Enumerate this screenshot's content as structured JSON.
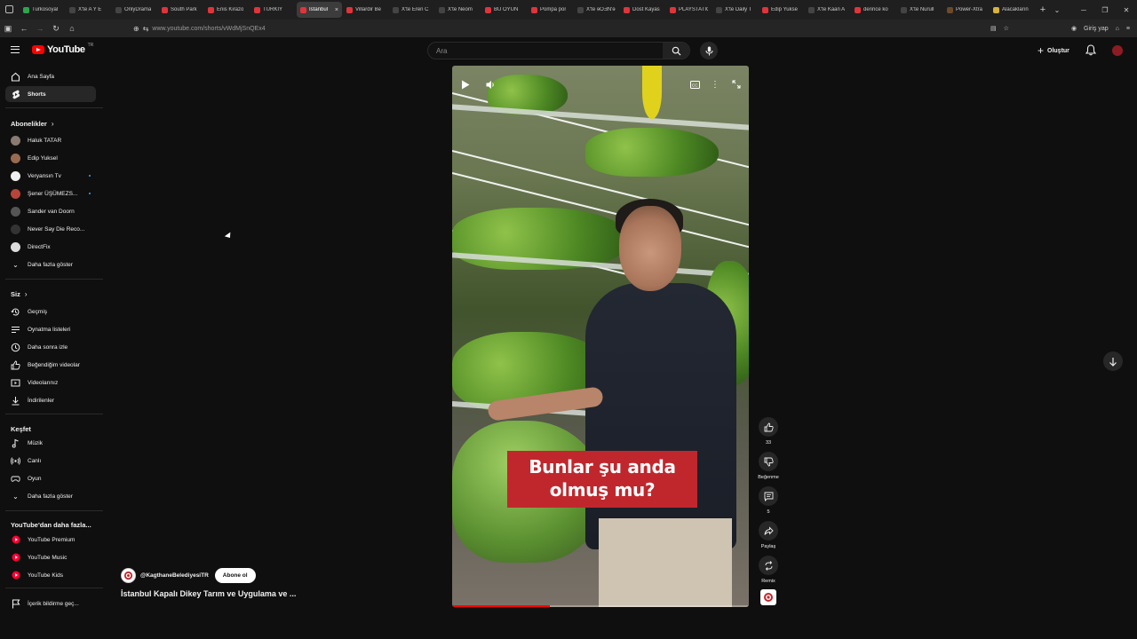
{
  "browser": {
    "tabs": [
      {
        "label": "Turkosoyal",
        "color": "#2da44e"
      },
      {
        "label": "X'te A Y E",
        "color": "#444444"
      },
      {
        "label": "OnlyDrama",
        "color": "#444444"
      },
      {
        "label": "South Park",
        "color": "#e0343a"
      },
      {
        "label": "Enis Kirazo",
        "color": "#e0343a"
      },
      {
        "label": "TÜRKİY",
        "color": "#e0343a"
      },
      {
        "label": "İstanbul",
        "color": "#e0343a",
        "active": true
      },
      {
        "label": "Villardir Be",
        "color": "#e0343a"
      },
      {
        "label": "X'te Eren C",
        "color": "#444444"
      },
      {
        "label": "X'te Neom",
        "color": "#444444"
      },
      {
        "label": "BU OYUN",
        "color": "#e0343a"
      },
      {
        "label": "Pompa por",
        "color": "#e0343a"
      },
      {
        "label": "X'te ɘOƎN'ɘ",
        "color": "#444444"
      },
      {
        "label": "Dost Kayas",
        "color": "#e0343a"
      },
      {
        "label": "PLAYSTATIO",
        "color": "#e0343a"
      },
      {
        "label": "X'te Daily T",
        "color": "#444444"
      },
      {
        "label": "Edip Yukse",
        "color": "#e0343a"
      },
      {
        "label": "X'te Kaan A",
        "color": "#444444"
      },
      {
        "label": "derince ko",
        "color": "#e0343a"
      },
      {
        "label": "X'te Nurull",
        "color": "#444444"
      },
      {
        "label": "Power-Xtra",
        "color": "#6b4a2a"
      },
      {
        "label": "Alacakların",
        "color": "#d8b23a"
      }
    ],
    "tab_close": "×",
    "new_tab": "+",
    "url": "www.youtube.com/shorts/vWdMjSnQEx4",
    "signin_label": "Giriş yap"
  },
  "header": {
    "logo_word": "YouTube",
    "logo_country": "TR",
    "search_placeholder": "Ara",
    "create_label": "Oluştur"
  },
  "sidebar": {
    "main": [
      {
        "label": "Ana Sayfa",
        "icon": "home-icon"
      },
      {
        "label": "Shorts",
        "icon": "shorts-icon",
        "active": true
      }
    ],
    "subscriptions_title": "Abonelikler",
    "subscriptions": [
      {
        "label": "Haluk TATAR",
        "color": "#8a7a70",
        "dot": false
      },
      {
        "label": "Edip Yuksel",
        "color": "#9a6a50",
        "dot": false
      },
      {
        "label": "Veryansın Tv",
        "color": "#f0f0f0",
        "dot": true
      },
      {
        "label": "Şener ÜŞÜMEZS...",
        "color": "#b8453a",
        "dot": true
      },
      {
        "label": "Sander van Doorn",
        "color": "#555555",
        "dot": false
      },
      {
        "label": "Never Say Die Reco...",
        "color": "#333333",
        "dot": false
      },
      {
        "label": "DirectFix",
        "color": "#dddddd",
        "dot": false
      }
    ],
    "show_more_1": "Daha fazla göster",
    "you_title": "Siz",
    "you": [
      {
        "label": "Geçmiş",
        "icon": "history-icon"
      },
      {
        "label": "Oynatma listeleri",
        "icon": "playlist-icon"
      },
      {
        "label": "Daha sonra izle",
        "icon": "clock-icon"
      },
      {
        "label": "Beğendiğim videolar",
        "icon": "like-icon"
      },
      {
        "label": "Videolarınız",
        "icon": "video-icon"
      },
      {
        "label": "İndirilenler",
        "icon": "download-icon"
      }
    ],
    "explore_title": "Keşfet",
    "explore": [
      {
        "label": "Müzik",
        "icon": "music-icon"
      },
      {
        "label": "Canlı",
        "icon": "live-icon"
      },
      {
        "label": "Oyun",
        "icon": "gaming-icon"
      }
    ],
    "show_more_2": "Daha fazla göster",
    "more_title": "YouTube'dan daha fazla...",
    "more": [
      {
        "label": "YouTube Premium"
      },
      {
        "label": "YouTube Music"
      },
      {
        "label": "YouTube Kids"
      }
    ],
    "report_label": "İçerik bildirme geç..."
  },
  "video": {
    "caption": "Bunlar şu anda olmuş mu?",
    "progress": 0.33
  },
  "actions": {
    "like_count": "33",
    "dislike_label": "Beğenme",
    "comment_count": "5",
    "share_label": "Paylaş",
    "remix_label": "Remix"
  },
  "channel": {
    "handle": "@KagthaneBelediyesiTR",
    "subscribe_label": "Abone ol",
    "title": "İstanbul Kapalı Dikey Tarım ve Uygulama ve ..."
  }
}
